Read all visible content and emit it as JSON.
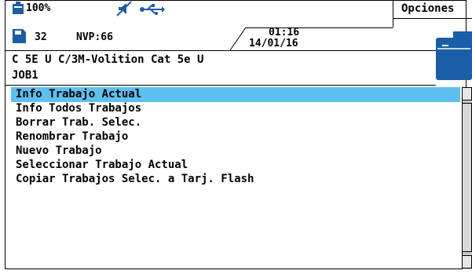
{
  "status": {
    "battery": "100%",
    "memory_count": "32",
    "nvp": "NVP:66",
    "time": "01:16",
    "date": "14/01/16"
  },
  "header": {
    "options_label": "Opciones",
    "cable_type": "C 5E U C/3M-Volition Cat 5e U",
    "job_name": "JOB1"
  },
  "menu": {
    "items": [
      {
        "label": "Info Trabajo Actual"
      },
      {
        "label": "Info Todos Trabajos"
      },
      {
        "label": "Borrar Trab. Selec."
      },
      {
        "label": "Renombrar Trabajo"
      },
      {
        "label": "Nuevo Trabajo"
      },
      {
        "label": "Seleccionar Trabajo Actual"
      },
      {
        "label": "Copiar Trabajos Selec. a Tarj. Flash"
      }
    ]
  },
  "colors": {
    "accent": "#1a5ea8",
    "selection": "#5cc0f0"
  }
}
